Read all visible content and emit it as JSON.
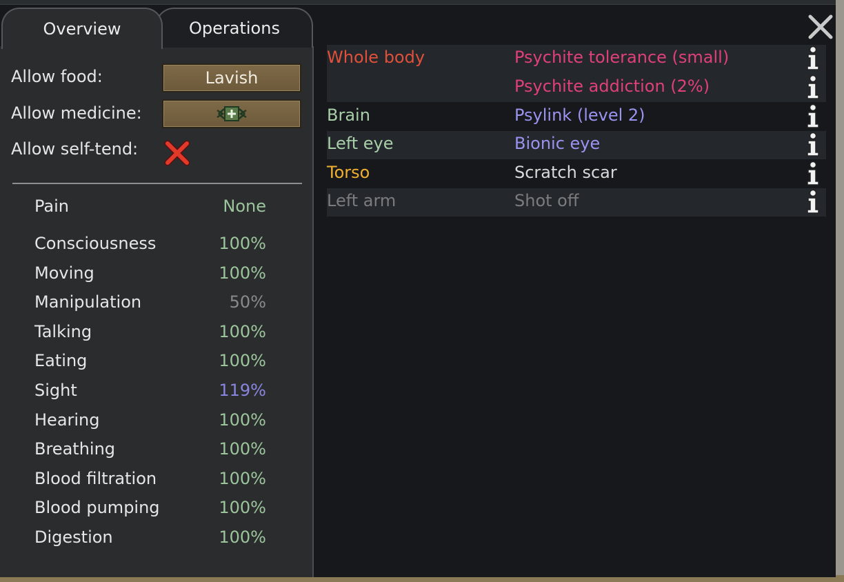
{
  "tabs": [
    {
      "label": "Overview"
    },
    {
      "label": "Operations"
    }
  ],
  "settings": {
    "allow_food_label": "Allow food:",
    "allow_food_value": "Lavish",
    "allow_medicine_label": "Allow medicine:",
    "allow_self_tend_label": "Allow self-tend:"
  },
  "pain": {
    "label": "Pain",
    "value": "None"
  },
  "capacities": [
    {
      "name": "Consciousness",
      "value": "100%",
      "color": "#9cc59c"
    },
    {
      "name": "Moving",
      "value": "100%",
      "color": "#9cc59c"
    },
    {
      "name": "Manipulation",
      "value": "50%",
      "color": "#8a8a8a"
    },
    {
      "name": "Talking",
      "value": "100%",
      "color": "#9cc59c"
    },
    {
      "name": "Eating",
      "value": "100%",
      "color": "#9cc59c"
    },
    {
      "name": "Sight",
      "value": "119%",
      "color": "#8a86e0"
    },
    {
      "name": "Hearing",
      "value": "100%",
      "color": "#9cc59c"
    },
    {
      "name": "Breathing",
      "value": "100%",
      "color": "#9cc59c"
    },
    {
      "name": "Blood filtration",
      "value": "100%",
      "color": "#9cc59c"
    },
    {
      "name": "Blood pumping",
      "value": "100%",
      "color": "#9cc59c"
    },
    {
      "name": "Digestion",
      "value": "100%",
      "color": "#9cc59c"
    }
  ],
  "hediffs": [
    {
      "part": "Whole body",
      "part_color": "#e0503a",
      "condition": "Psychite tolerance (small)",
      "condition_color": "#e0407a"
    },
    {
      "part": "",
      "part_color": "#e0503a",
      "condition": "Psychite addiction (2%)",
      "condition_color": "#e0407a"
    },
    {
      "part": "Brain",
      "part_color": "#a9cfa9",
      "condition": "Psylink (level 2)",
      "condition_color": "#9a93f0"
    },
    {
      "part": "Left eye",
      "part_color": "#a9cfa9",
      "condition": "Bionic eye",
      "condition_color": "#9a93f0"
    },
    {
      "part": "Torso",
      "part_color": "#f0b030",
      "condition": "Scratch scar",
      "condition_color": "#d9d9d9"
    },
    {
      "part": "Left arm",
      "part_color": "#7a7c7e",
      "condition": "Shot off",
      "condition_color": "#7a7c7e"
    }
  ],
  "icons": {
    "close": "close-icon",
    "info": "info-icon",
    "self_tend": "cross-x-icon",
    "medicine": "medicine-icon"
  }
}
